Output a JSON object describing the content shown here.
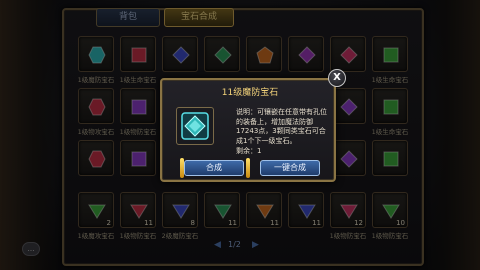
{
  "tabs": [
    {
      "label": "背包",
      "active": false
    },
    {
      "label": "宝石合成",
      "active": true
    }
  ],
  "grid": {
    "rows": [
      [
        {
          "color": "#2fb7b8",
          "label": "1级魔防宝石",
          "count": ""
        },
        {
          "color": "#c23046",
          "label": "1级生命宝石",
          "count": ""
        },
        {
          "color": "#3c4cc8",
          "label": "",
          "count": ""
        },
        {
          "color": "#2d9a5a",
          "label": "",
          "count": ""
        },
        {
          "color": "#c86a20",
          "label": "",
          "count": ""
        },
        {
          "color": "#9a38b8",
          "label": "",
          "count": ""
        },
        {
          "color": "#c83464",
          "label": "",
          "count": ""
        },
        {
          "color": "#3ca83c",
          "label": "1级生命宝石",
          "count": ""
        }
      ],
      [
        {
          "color": "#c23046",
          "label": "1级物攻宝石",
          "count": ""
        },
        {
          "color": "#8a3cc8",
          "label": "1级物防宝石",
          "count": ""
        },
        {
          "color": "",
          "label": "",
          "count": ""
        },
        {
          "color": "",
          "label": "",
          "count": ""
        },
        {
          "color": "",
          "label": "",
          "count": ""
        },
        {
          "color": "",
          "label": "",
          "count": ""
        },
        {
          "color": "#8a3cc8",
          "label": "",
          "count": ""
        },
        {
          "color": "#3ca83c",
          "label": "1级生命宝石",
          "count": ""
        }
      ],
      [
        {
          "color": "#c23046",
          "label": "",
          "count": ""
        },
        {
          "color": "#8a3cc8",
          "label": "",
          "count": ""
        },
        {
          "color": "",
          "label": "",
          "count": ""
        },
        {
          "color": "",
          "label": "",
          "count": ""
        },
        {
          "color": "",
          "label": "",
          "count": ""
        },
        {
          "color": "",
          "label": "",
          "count": ""
        },
        {
          "color": "#8a3cc8",
          "label": "",
          "count": ""
        },
        {
          "color": "#3ca83c",
          "label": "",
          "count": ""
        }
      ],
      [
        {
          "color": "#3ca83c",
          "label": "1级魔攻宝石",
          "count": "2"
        },
        {
          "color": "#c23046",
          "label": "1级物防宝石",
          "count": "11"
        },
        {
          "color": "#3c4cc8",
          "label": "2级魔防宝石",
          "count": "8"
        },
        {
          "color": "#2d9a5a",
          "label": "",
          "count": "11"
        },
        {
          "color": "#c86a20",
          "label": "",
          "count": "11"
        },
        {
          "color": "#3c4cc8",
          "label": "",
          "count": "11"
        },
        {
          "color": "#c83464",
          "label": "1级物防宝石",
          "count": "12"
        },
        {
          "color": "#3ca83c",
          "label": "1级物防宝石",
          "count": "10"
        }
      ]
    ]
  },
  "popup": {
    "title": "11级魔防宝石",
    "icon_color": "#2fb7b8",
    "description": "说明：可镶嵌在任意带有孔位的装备上，增加魔法防御17243点，3颗同类宝石可合成1个下一级宝石。",
    "remain": "剩余：1",
    "compose_label": "合成",
    "onekey_label": "一键合成",
    "close_label": "X"
  },
  "pager": {
    "text": "1/2"
  }
}
